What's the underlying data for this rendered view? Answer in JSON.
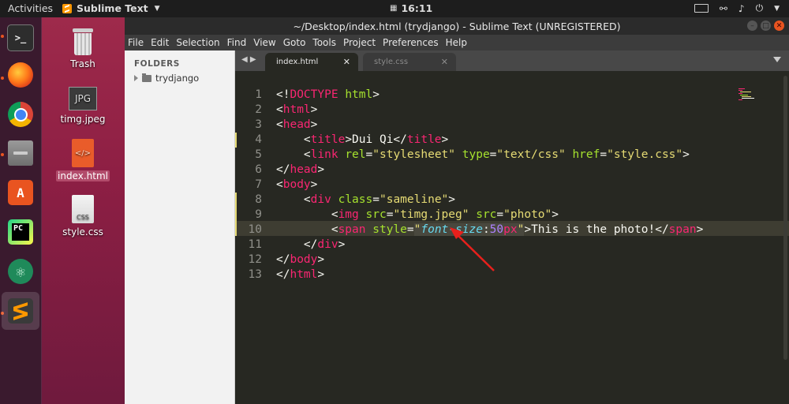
{
  "topbar": {
    "activities": "Activities",
    "app_name": "Sublime Text",
    "time": "16:11"
  },
  "desktop": {
    "icons": [
      {
        "label": "Trash"
      },
      {
        "label": "timg.jpeg",
        "badge": "JPG"
      },
      {
        "label": "index.html"
      },
      {
        "label": "style.css",
        "badge": "CSS"
      }
    ]
  },
  "dock": {
    "apps": [
      "terminal-icon",
      "firefox-icon",
      "chrome-icon",
      "files-icon",
      "software-center-icon",
      "pycharm-icon",
      "atom-icon",
      "sublime-text-icon"
    ],
    "pycharm_label": "PC",
    "terminal_label": ">_"
  },
  "window": {
    "title": "~/Desktop/index.html (trydjango) - Sublime Text (UNREGISTERED)",
    "menu": [
      "File",
      "Edit",
      "Selection",
      "Find",
      "View",
      "Goto",
      "Tools",
      "Project",
      "Preferences",
      "Help"
    ]
  },
  "sidebar": {
    "header": "FOLDERS",
    "folder": "trydjango"
  },
  "tabs": [
    {
      "name": "index.html",
      "active": true
    },
    {
      "name": "style.css",
      "active": false
    }
  ],
  "editor": {
    "line_numbers": [
      "1",
      "2",
      "3",
      "4",
      "5",
      "6",
      "7",
      "8",
      "9",
      "10",
      "11",
      "12",
      "13"
    ],
    "code": {
      "l1": {
        "a": "<!",
        "b": "DOCTYPE",
        "c": " ",
        "d": "html",
        "e": ">"
      },
      "l2": {
        "a": "<",
        "b": "html",
        "c": ">"
      },
      "l3": {
        "a": "<",
        "b": "head",
        "c": ">"
      },
      "l4": {
        "a": "    <",
        "b": "title",
        "c": ">Dui Qi</",
        "d": "title",
        "e": ">"
      },
      "l5": {
        "a": "    <",
        "b": "link",
        "c": " ",
        "d": "rel",
        "e": "=",
        "f": "\"stylesheet\"",
        "g": " ",
        "h": "type",
        "i": "=",
        "j": "\"text/css\"",
        "k": " ",
        "l": "href",
        "m": "=",
        "n": "\"style.css\"",
        "o": ">"
      },
      "l6": {
        "a": "</",
        "b": "head",
        "c": ">"
      },
      "l7": {
        "a": "<",
        "b": "body",
        "c": ">"
      },
      "l8": {
        "a": "    <",
        "b": "div",
        "c": " ",
        "d": "class",
        "e": "=",
        "f": "\"sameline\"",
        "g": ">"
      },
      "l9": {
        "a": "        <",
        "b": "img",
        "c": " ",
        "d": "src",
        "e": "=",
        "f": "\"timg.jpeg\"",
        "g": " ",
        "h": "src",
        "i": "=",
        "j": "\"photo\"",
        "k": ">"
      },
      "l10": {
        "a": "        <",
        "b": "span",
        "c": " ",
        "d": "style",
        "e": "=",
        "f": "\"",
        "g": "font-size",
        "h": ":",
        "i": "50",
        "j": "px",
        "k": "\"",
        "l": ">This is the photo!</",
        "m": "span",
        "n": ">"
      },
      "l11": {
        "a": "    </",
        "b": "div",
        "c": ">"
      },
      "l12": {
        "a": "</",
        "b": "body",
        "c": ">"
      },
      "l13": {
        "a": "</",
        "b": "html",
        "c": ">"
      }
    }
  },
  "colors": {
    "accent": "#e95420",
    "arrow": "#e8201c",
    "editor_bg": "#272822"
  }
}
